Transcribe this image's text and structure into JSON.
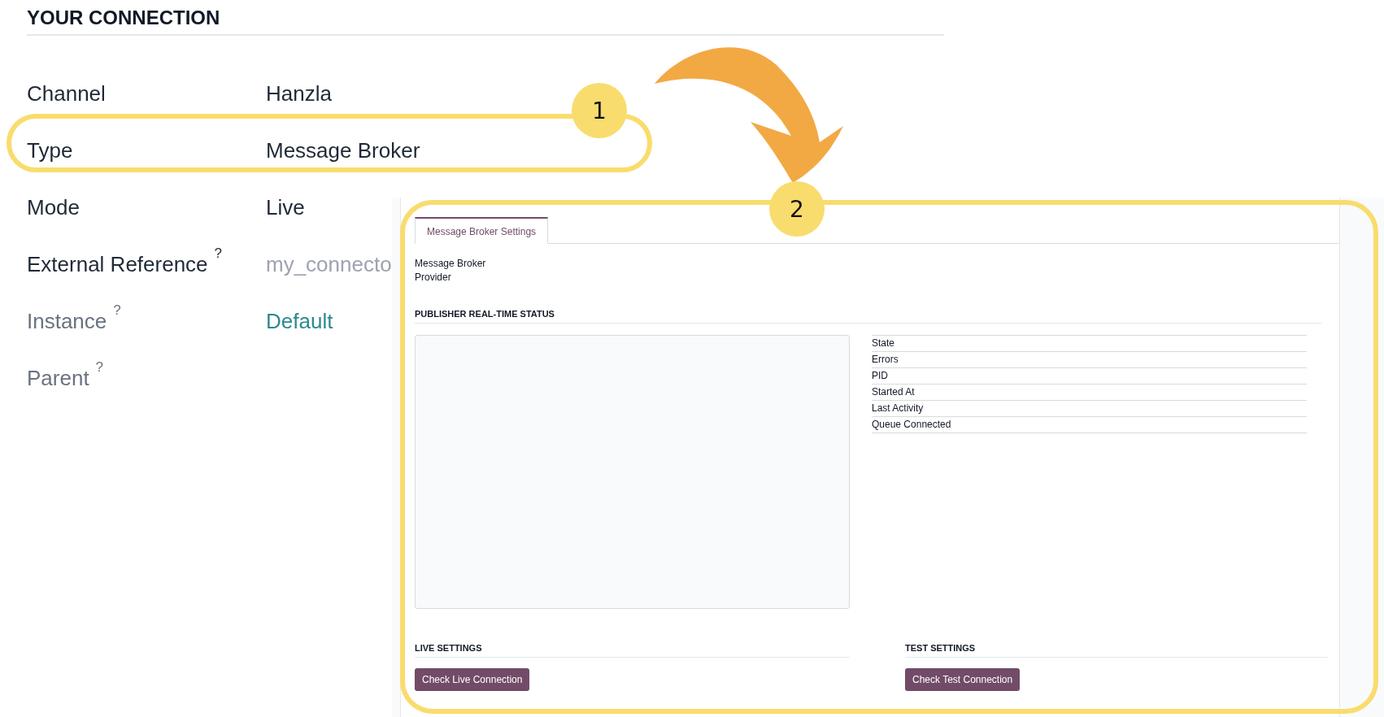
{
  "section_title": "YOUR CONNECTION",
  "fields": [
    {
      "label": "Channel",
      "muted": false,
      "kind": "text",
      "value": "Hanzla"
    },
    {
      "label": "Type",
      "muted": false,
      "kind": "text",
      "value": "Message Broker"
    },
    {
      "label": "Mode",
      "muted": false,
      "kind": "text",
      "value": "Live"
    },
    {
      "label": "External Reference",
      "help": "?",
      "muted": false,
      "kind": "text",
      "placeholder": "my_connecto"
    },
    {
      "label": "Instance",
      "help": "?",
      "muted": true,
      "kind": "link",
      "value": "Default"
    },
    {
      "label": "Parent",
      "help": "?",
      "muted": true,
      "kind": "text"
    }
  ],
  "broker_panel": {
    "tabs": [
      {
        "label": "Message Broker Settings",
        "selected": true
      }
    ],
    "provider_label": "Message Broker Provider",
    "status_title": "PUBLISHER REAL-TIME STATUS",
    "status_fields": [
      "State",
      "Errors",
      "PID",
      "Started At",
      "Last Activity",
      "Queue Connected"
    ],
    "live_settings": {
      "title": "LIVE SETTINGS",
      "button": "Check Live Connection"
    },
    "test_settings": {
      "title": "TEST SETTINGS",
      "button": "Check Test Connection"
    }
  },
  "annotations": [
    {
      "number": "1"
    },
    {
      "number": "2"
    }
  ]
}
